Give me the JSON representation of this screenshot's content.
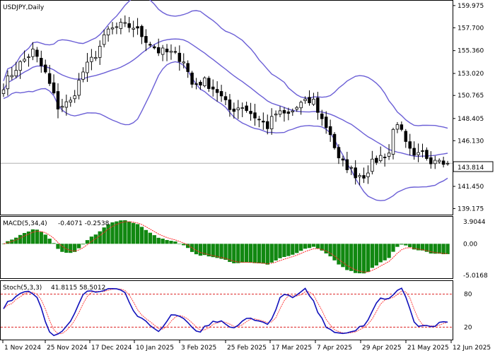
{
  "chart_data": {
    "type": "candlestick",
    "symbol": "USDJPY",
    "timeframe": "Daily",
    "title": "USDJPY,Daily",
    "current_price": "143.814",
    "x_tick_labels": [
      "1 Nov 2024",
      "25 Nov 2024",
      "17 Dec 2024",
      "10 Jan 2025",
      "3 Feb 2025",
      "25 Feb 2025",
      "17 Mar 2025",
      "7 Apr 2025",
      "29 Apr 2025",
      "21 May 2025",
      "12 Jun 2025"
    ],
    "price_panel": {
      "y_tick_labels": [
        "159.975",
        "157.700",
        "155.360",
        "153.020",
        "150.765",
        "148.405",
        "146.130",
        "143.814",
        "141.450",
        "139.175"
      ],
      "ylim": [
        138.7,
        160.4
      ],
      "close_anchors": [
        [
          0,
          151.8
        ],
        [
          3,
          153.6
        ],
        [
          7,
          155.3
        ],
        [
          10,
          153.0
        ],
        [
          13,
          149.6
        ],
        [
          16,
          150.1
        ],
        [
          19,
          153.2
        ],
        [
          22,
          155.0
        ],
        [
          25,
          157.4
        ],
        [
          28,
          157.9
        ],
        [
          31,
          157.8
        ],
        [
          34,
          156.5
        ],
        [
          37,
          155.3
        ],
        [
          40,
          155.1
        ],
        [
          43,
          154.4
        ],
        [
          45,
          151.9
        ],
        [
          48,
          152.2
        ],
        [
          51,
          151.2
        ],
        [
          54,
          149.3
        ],
        [
          57,
          149.7
        ],
        [
          60,
          148.6
        ],
        [
          63,
          147.6
        ],
        [
          65,
          148.9
        ],
        [
          68,
          148.8
        ],
        [
          71,
          149.9
        ],
        [
          74,
          150.2
        ],
        [
          76,
          148.3
        ],
        [
          78,
          146.9
        ],
        [
          80,
          144.1
        ],
        [
          82,
          143.5
        ],
        [
          84,
          142.7
        ],
        [
          86,
          142.6
        ],
        [
          88,
          143.8
        ],
        [
          90,
          144.5
        ],
        [
          92,
          144.9
        ],
        [
          93,
          147.2
        ],
        [
          94,
          148.1
        ],
        [
          96,
          145.7
        ],
        [
          98,
          144.3
        ],
        [
          100,
          144.8
        ],
        [
          102,
          144.2
        ],
        [
          104,
          144.5
        ],
        [
          106,
          143.8
        ]
      ]
    },
    "indicators": {
      "bollinger": {
        "period": 20,
        "deviations": 2,
        "color": "#6b5fd6"
      },
      "macd": {
        "label": "MACD(5,34,4)",
        "fast": 5,
        "slow": 34,
        "signal": 4,
        "values_text": "-0.4071 -0.2538",
        "y_tick_labels": [
          "3.9044",
          "0.00",
          "-5.0168"
        ],
        "ylim": [
          -5.0168,
          3.9044
        ],
        "histogram_color": "#118811",
        "signal_color": "#ff2222"
      },
      "stochastic": {
        "label": "Stoch(5,3,3)",
        "k": 5,
        "d": 3,
        "slowing": 3,
        "values_text": "41.8115 58.5012",
        "y_tick_labels": [
          "80",
          "20"
        ],
        "levels": [
          80,
          20
        ],
        "k_color": "#1111bb",
        "d_color": "#ff4444"
      }
    },
    "colors": {
      "bull": "#ffffff",
      "bear": "#000000",
      "grid": "#c0c0c0",
      "price_line": "#b0b0b0"
    }
  }
}
